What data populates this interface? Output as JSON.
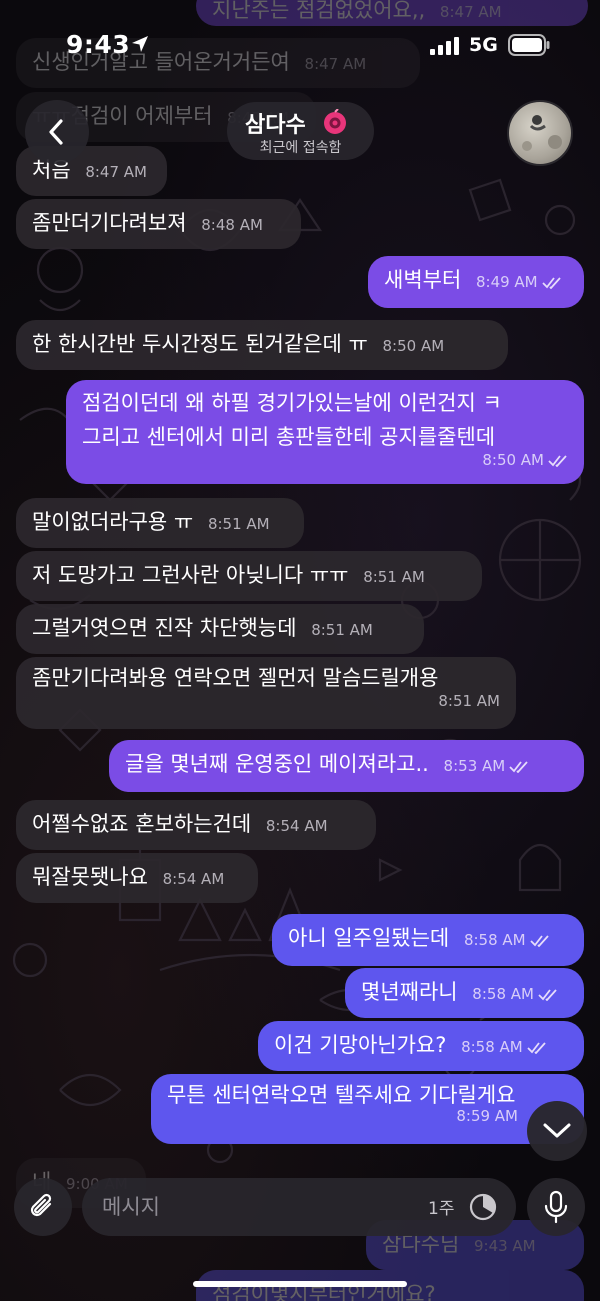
{
  "status_bar": {
    "time": "9:43",
    "network": "5G"
  },
  "header": {
    "title": "삼다수",
    "status": "최근에 접속함"
  },
  "messages": [
    {
      "dir": "out",
      "text": "지난주는 점검없었어요,,",
      "time": "8:47 AM"
    },
    {
      "dir": "in",
      "text": "신생인거알고 들어온거거든여",
      "time": "8:47 AM"
    },
    {
      "dir": "in",
      "text": "ㅠㅠ점검이 어제부터",
      "time": "8:47 AM"
    },
    {
      "dir": "in",
      "text": "처음",
      "time": "8:47 AM"
    },
    {
      "dir": "in",
      "text": "좀만더기다려보져",
      "time": "8:48 AM"
    },
    {
      "dir": "out",
      "text": "새벽부터",
      "time": "8:49 AM"
    },
    {
      "dir": "in",
      "text": "한 한시간반 두시간정도 된거같은데 ㅠ",
      "time": "8:50 AM"
    },
    {
      "dir": "out",
      "line1": "점검이던데 왜 하필 경기가있는날에 이런건지 ㅋ",
      "line2": "그리고 센터에서 미리 총판들한테 공지를줄텐데",
      "time": "8:50 AM"
    },
    {
      "dir": "in",
      "text": "말이없더라구용 ㅠ",
      "time": "8:51 AM"
    },
    {
      "dir": "in",
      "text": "저 도망가고 그런사란 아닞니다 ㅠㅠ",
      "time": "8:51 AM"
    },
    {
      "dir": "in",
      "text": "그럴거엿으면 진작 차단햇능데",
      "time": "8:51 AM"
    },
    {
      "dir": "in",
      "text": "좀만기다려봐용 연락오면 젤먼저 말슴드릴개용",
      "time": "8:51 AM"
    },
    {
      "dir": "out",
      "text": "글을 몇년째 운영중인 메이져라고..",
      "time": "8:53 AM"
    },
    {
      "dir": "in",
      "text": "어쩔수없죠 혼보하는건데",
      "time": "8:54 AM"
    },
    {
      "dir": "in",
      "text": "뭐잘못됏나요",
      "time": "8:54 AM"
    },
    {
      "dir": "out",
      "text": "아니 일주일됐는데",
      "time": "8:58 AM"
    },
    {
      "dir": "out",
      "text": "몇년째라니",
      "time": "8:58 AM"
    },
    {
      "dir": "out",
      "text": "이건 기망아닌가요?",
      "time": "8:58 AM"
    },
    {
      "dir": "out",
      "text": "무튼 센터연락오면 텔주세요 기다릴게요",
      "time": "8:59 AM"
    },
    {
      "dir": "in",
      "text": "네",
      "time": "9:00 AM"
    },
    {
      "dir": "out",
      "text": "삼다수님",
      "time": "9:43 AM"
    },
    {
      "dir": "out",
      "text": "점검이몇시부터인거에요?",
      "time": ""
    }
  ],
  "input": {
    "placeholder": "메시지",
    "timer_label": "1주"
  },
  "colors": {
    "outgoing_purple": "#7b4ce6",
    "outgoing_blue": "#5e56ee",
    "incoming": "#2c282d"
  }
}
